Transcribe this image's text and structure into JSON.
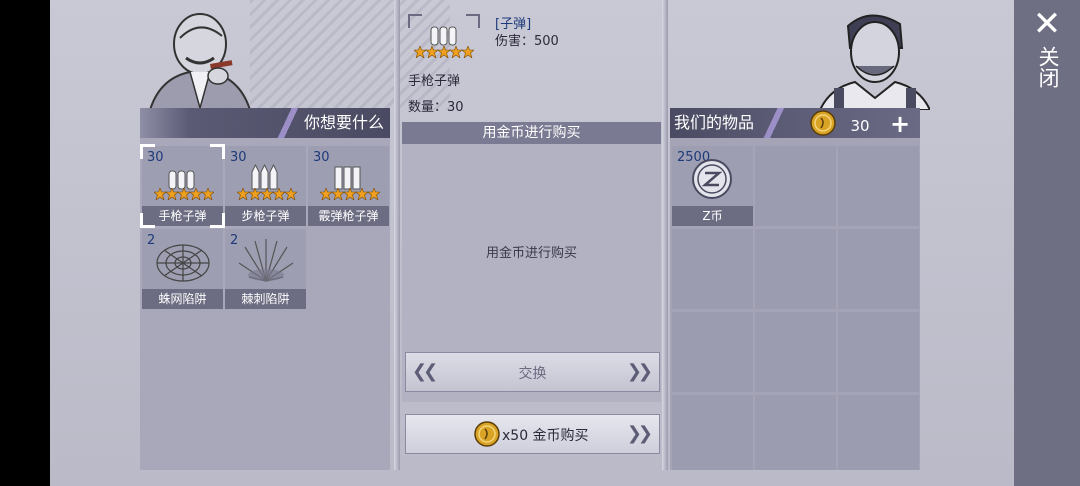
{
  "close": {
    "label": "关闭",
    "icon": "close-icon"
  },
  "want_panel": {
    "title": "你想要什么",
    "items": [
      {
        "count": "30",
        "label": "手枪子弹",
        "icon": "pistol-bullets-icon",
        "stars": 5,
        "selected": true
      },
      {
        "count": "30",
        "label": "步枪子弹",
        "icon": "rifle-bullets-icon",
        "stars": 5,
        "selected": false
      },
      {
        "count": "30",
        "label": "霰弹枪子弹",
        "icon": "shotgun-shells-icon",
        "stars": 5,
        "selected": false
      },
      {
        "count": "2",
        "label": "蛛网陷阱",
        "icon": "spider-web-trap-icon",
        "selected": false
      },
      {
        "count": "2",
        "label": "棘刺陷阱",
        "icon": "thorn-trap-icon",
        "selected": false
      }
    ]
  },
  "detail": {
    "category": "[子弹]",
    "damage_label": "伤害：500",
    "name": "手枪子弹",
    "quantity_label": "数量：30",
    "buy_header": "用金币进行购买",
    "buy_hint": "用金币进行购买",
    "exchange_label": "交换",
    "buy_button_label": "x50 金币购买"
  },
  "our_panel": {
    "title": "我们的物品",
    "coins": "30",
    "items": [
      {
        "count": "2500",
        "label": "Z币",
        "icon": "z-coin-icon"
      }
    ]
  },
  "colors": {
    "accent_blue": "#1d3a7a",
    "star": "#f0a020",
    "coin_gold": "#d9a326"
  }
}
